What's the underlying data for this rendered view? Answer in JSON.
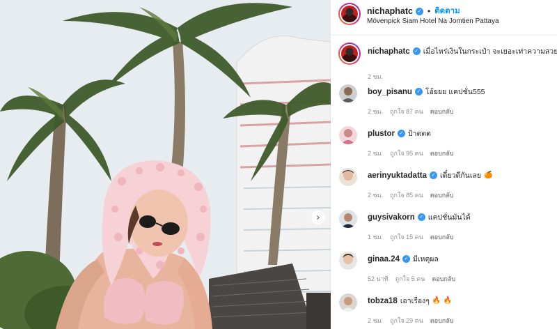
{
  "post": {
    "username": "nichaphatc",
    "follow_label": "ติดตาม",
    "separator": "•",
    "location": "Mövenpick Siam Hotel Na Jomtien Pattaya",
    "caption_text": "เมื่อไหร่เงินในกระเป๋า จะเยอะเท่าความสวย",
    "caption_time": "2 ชม.",
    "carousel_next_glyph": "›"
  },
  "comments": [
    {
      "username": "boy_pisanu",
      "text": "โอ้ยยย แคปชั่น555",
      "emoji": "",
      "time": "2 ชม.",
      "likes": "ถูกใจ 87 คน",
      "reply": "ตอบกลับ",
      "avatar": "avatar-boy"
    },
    {
      "username": "plustor",
      "text": "ป้าตตต",
      "emoji": "",
      "time": "2 ชม.",
      "likes": "ถูกใจ 95 คน",
      "reply": "ตอบกลับ",
      "avatar": "avatar-plus"
    },
    {
      "username": "aerinyuktadatta",
      "text": "เดี๋ยวดีกันเลย",
      "emoji": "🍊",
      "time": "2 ชม.",
      "likes": "ถูกใจ 85 คน",
      "reply": "ตอบกลับ",
      "avatar": "avatar-aerin"
    },
    {
      "username": "guysivakorn",
      "text": "แคปชั่นมันได้",
      "emoji": "",
      "time": "1 ชม.",
      "likes": "ถูกใจ 15 คน",
      "reply": "ตอบกลับ",
      "avatar": "avatar-guy"
    },
    {
      "username": "ginaa.24",
      "text": "มีเหตุผล",
      "emoji": "",
      "time": "52 นาที",
      "likes": "ถูกใจ 5 คน",
      "reply": "ตอบกลับ",
      "avatar": "avatar-gina"
    },
    {
      "username": "tobza18",
      "text": "เอาเรื่องๆ",
      "emoji": "🔥 🔥",
      "time": "2 ชม.",
      "likes": "ถูกใจ 29 คน",
      "reply": "ตอบกลับ",
      "avatar": "avatar-tob"
    }
  ],
  "colors": {
    "verified": "#3897f0",
    "follow": "#0095f6",
    "meta": "#8e8e8e"
  },
  "icons": {
    "verified": "verified-badge-icon",
    "next": "chevron-right-icon"
  }
}
